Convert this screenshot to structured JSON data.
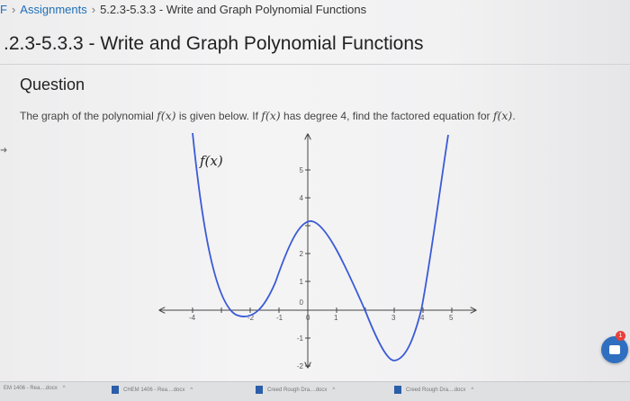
{
  "breadcrumb": {
    "items": [
      "F",
      "Assignments",
      "5.2.3-5.3.3 - Write and Graph Polynomial Functions"
    ],
    "separator": "›"
  },
  "page_title": ".2.3-5.3.3 - Write and Graph Polynomial Functions",
  "question": {
    "heading": "Question",
    "text_part1": "The graph of the polynomial ",
    "fx": "f(x)",
    "text_part2": " is given below. If ",
    "text_part3": " has degree ",
    "degree": "4",
    "text_part4": ", find the factored equation for ",
    "text_part5": "."
  },
  "graph": {
    "function_label": "f(x)",
    "x_ticks": [
      "-4",
      "-2",
      "-1",
      "0",
      "1",
      "3",
      "4",
      "5"
    ],
    "y_ticks": [
      "5",
      "4",
      "2",
      "1",
      "0",
      "-1",
      "-2"
    ],
    "curve_color": "#3b5bd6"
  },
  "downloads": [
    {
      "name": "EM 1406 - Rea....docx"
    },
    {
      "name": "CHEM 1406 - Rea....docx"
    },
    {
      "name": "Creed Rough Dra....docx"
    },
    {
      "name": "Creed Rough Dra....docx"
    }
  ],
  "badge": "1",
  "colors": {
    "link": "#1e6fb8",
    "accent": "#2f6fc0",
    "badge": "#e8423a"
  }
}
